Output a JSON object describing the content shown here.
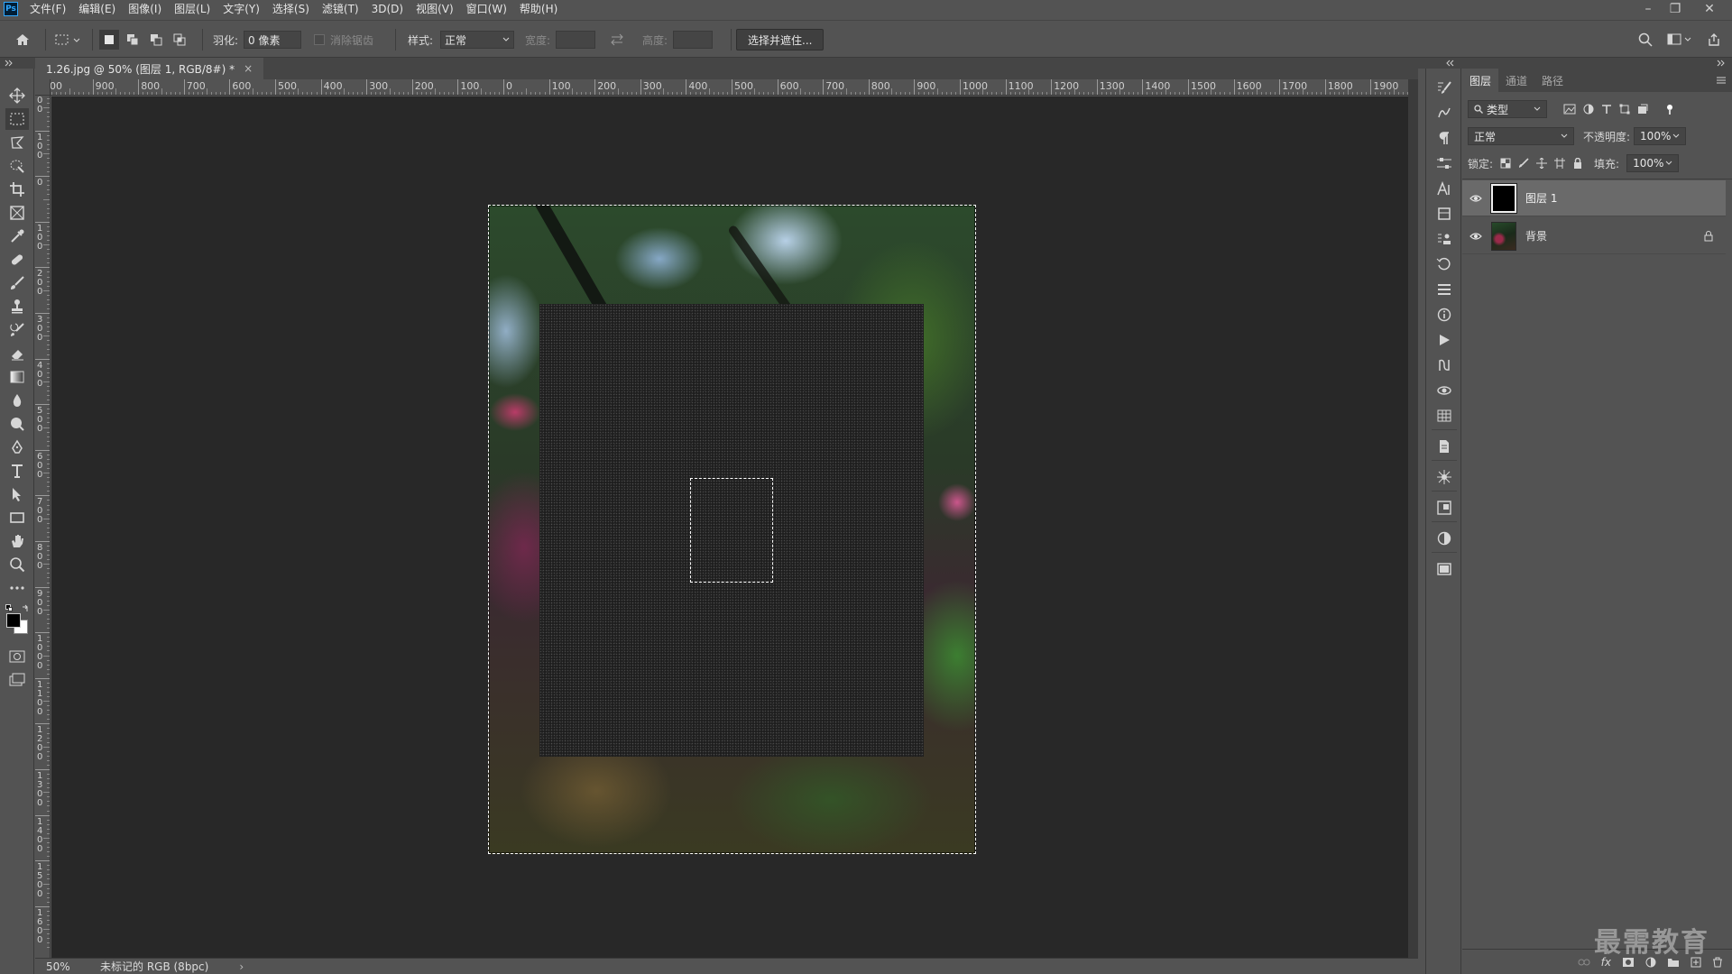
{
  "app": {
    "logo": "Ps"
  },
  "menu": [
    "文件(F)",
    "编辑(E)",
    "图像(I)",
    "图层(L)",
    "文字(Y)",
    "选择(S)",
    "滤镜(T)",
    "3D(D)",
    "视图(V)",
    "窗口(W)",
    "帮助(H)"
  ],
  "window_controls": {
    "minimize": "–",
    "restore": "❐",
    "close": "✕"
  },
  "options": {
    "feather_label": "羽化:",
    "feather_value": "0 像素",
    "antialias_label": "消除锯齿",
    "style_label": "样式:",
    "style_value": "正常",
    "width_label": "宽度:",
    "height_label": "高度:",
    "select_mask_button": "选择并遮住..."
  },
  "document": {
    "tab_title": "1.26.jpg @ 50% (图层 1, RGB/8#) *",
    "tab_close": "×",
    "zoom": "50%",
    "color_profile": "未标记的 RGB (8bpc)",
    "status_arrow": "›"
  },
  "ruler": {
    "h_labels": [
      "00",
      "900",
      "800",
      "700",
      "600",
      "500",
      "400",
      "300",
      "200",
      "100",
      "0",
      "100",
      "200",
      "300",
      "400",
      "500",
      "600",
      "700",
      "800",
      "900",
      "1000",
      "1100",
      "1200",
      "1300",
      "1400",
      "1500",
      "1600",
      "1700",
      "1800",
      "1900",
      "200"
    ],
    "v_labels": [
      "2 0 0",
      "1 0 0",
      "0",
      "1 0 0",
      "2 0 0",
      "3 0 0",
      "4 0 0",
      "5 0 0",
      "6 0 0",
      "7 0 0",
      "8 0 0",
      "9 0 0",
      "1 0 0 0",
      "1 1 0 0",
      "1 2 0 0",
      "1 3 0 0",
      "1 4 0 0",
      "1 5 0 0",
      "1 6 0 0"
    ]
  },
  "layers_panel": {
    "tabs": [
      "图层",
      "通道",
      "路径"
    ],
    "filter_kind": "类型",
    "blend_mode": "正常",
    "opacity_label": "不透明度:",
    "opacity_value": "100%",
    "lock_label": "锁定:",
    "fill_label": "填充:",
    "fill_value": "100%",
    "layers": [
      {
        "name": "图层 1",
        "selected": true,
        "locked": false
      },
      {
        "name": "背景",
        "selected": false,
        "locked": true
      }
    ]
  },
  "tools": [
    "move-tool",
    "marquee-tool",
    "lasso-tool",
    "quick-select-tool",
    "crop-tool",
    "frame-tool",
    "eyedropper-tool",
    "healing-brush-tool",
    "brush-tool",
    "clone-stamp-tool",
    "history-brush-tool",
    "eraser-tool",
    "gradient-tool",
    "blur-tool",
    "dodge-tool",
    "pen-tool",
    "type-tool",
    "path-select-tool",
    "rectangle-tool",
    "hand-tool",
    "zoom-tool",
    "more-tools"
  ],
  "colors": {
    "foreground": "#000000",
    "background": "#ffffff",
    "accent": "#31a8ff"
  },
  "watermark": "最需教育"
}
